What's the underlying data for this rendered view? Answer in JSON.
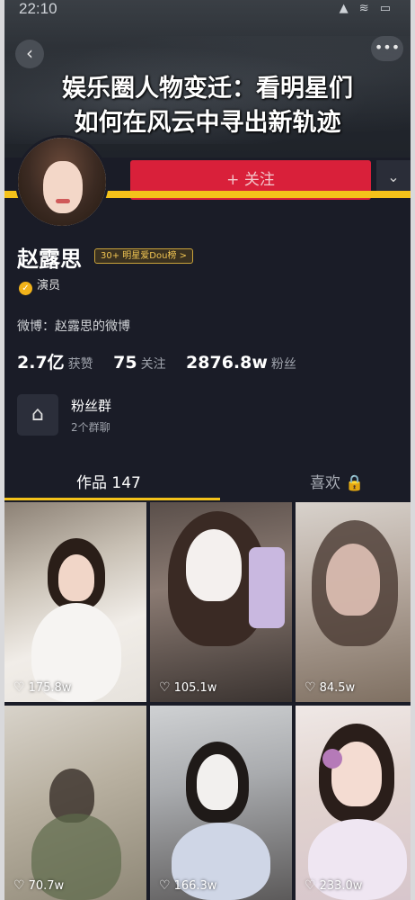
{
  "status_bar": {
    "time": "22:10",
    "icons": "▲ ≋ ▭"
  },
  "headline": {
    "line1": "娱乐圈人物变迁：看明星们",
    "line2": "如何在风云中寻出新轨迹"
  },
  "header": {
    "back_icon": "chevron-left-icon",
    "more_icon": "ellipsis-icon",
    "follow_label": "+ 关注",
    "dropdown_icon": "chevron-down-icon"
  },
  "profile": {
    "name": "赵露思",
    "rank_badge": "30+ 明星爱Dou榜 >",
    "verify_label": "演员",
    "weibo": "微博：赵露思的微博",
    "stats": [
      {
        "value": "2.7亿",
        "label": "获赞"
      },
      {
        "value": "75",
        "label": "关注"
      },
      {
        "value": "2876.8w",
        "label": "粉丝"
      }
    ],
    "fans_group": {
      "title": "粉丝群",
      "subtitle": "2个群聊"
    }
  },
  "tabs": {
    "works": "作品 147",
    "likes": "喜欢 🔒"
  },
  "videos": [
    {
      "likes": "175.8w"
    },
    {
      "likes": "105.1w"
    },
    {
      "likes": "84.5w"
    },
    {
      "likes": "70.7w"
    },
    {
      "likes": "166.3w"
    },
    {
      "likes": "233.0w"
    }
  ],
  "colors": {
    "accent_yellow": "#f4c21a",
    "follow_red": "#d9203a",
    "background": "#1a1c27"
  }
}
